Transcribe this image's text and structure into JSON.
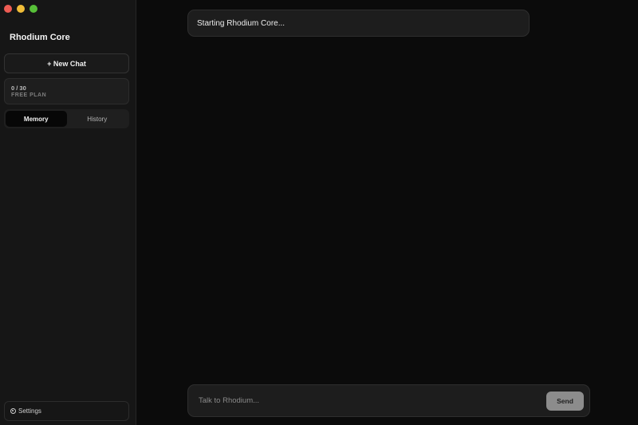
{
  "window": {
    "controls": [
      "close",
      "minimize",
      "zoom"
    ]
  },
  "sidebar": {
    "title": "Rhodium Core",
    "new_chat_label": "+ New Chat",
    "usage": {
      "count": "0 / 30",
      "plan": "FREE PLAN"
    },
    "tabs": [
      {
        "label": "Memory",
        "active": true
      },
      {
        "label": "History",
        "active": false
      }
    ],
    "settings_label": "Settings",
    "settings_icon": "gear-icon"
  },
  "main": {
    "status_message": "Starting Rhodium Core...",
    "composer": {
      "placeholder": "Talk to Rhodium...",
      "value": "",
      "send_label": "Send"
    }
  },
  "colors": {
    "background": "#0b0b0b",
    "sidebar": "#161616",
    "bubble": "#1d1d1d",
    "send_button": "#8c8c8c",
    "traffic_red": "#ee5c54",
    "traffic_yellow": "#f0bd38",
    "traffic_green": "#57c038"
  }
}
